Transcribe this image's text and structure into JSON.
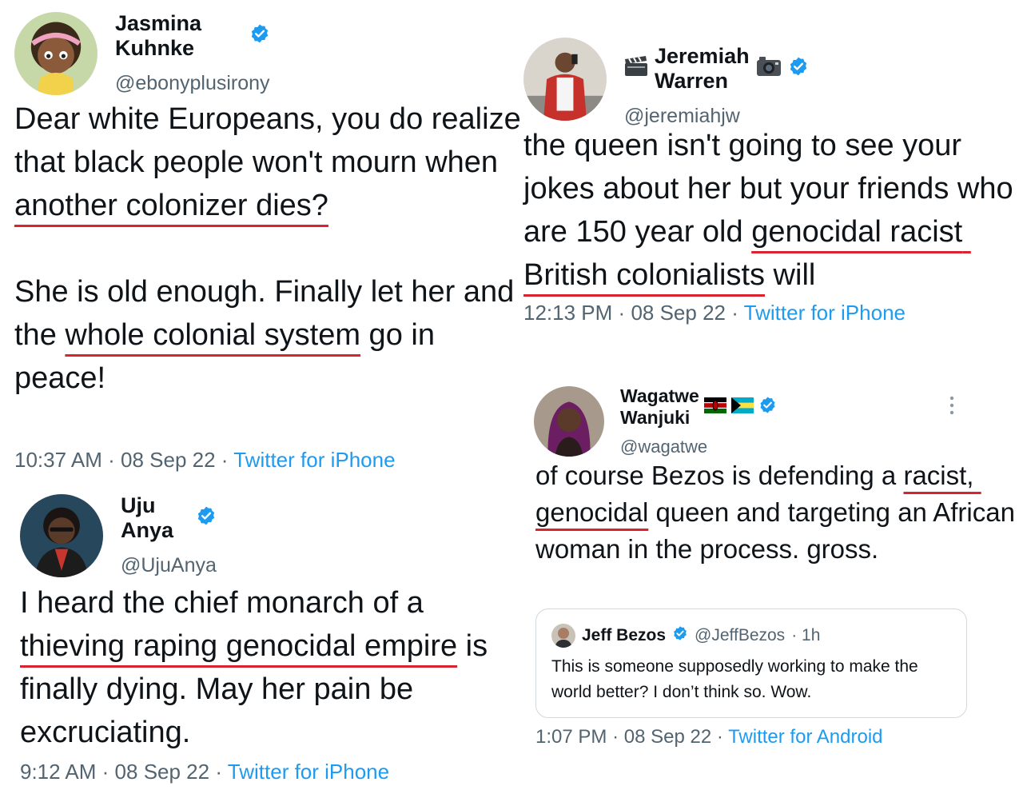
{
  "tweets": [
    {
      "name": "Jasmina Kuhnke",
      "handle": "@ebonyplusirony",
      "verified": true,
      "text_1": "Dear white Europeans, you do realize that black people won't mourn when ",
      "text_ul_1": "another colonizer dies?",
      "text_2": "\n\nShe is old enough. Finally let her and the ",
      "text_ul_2": "whole colonial system",
      "text_3": " go in peace!",
      "time": "10:37 AM",
      "date": "08 Sep 22",
      "source": "Twitter for iPhone",
      "separator": "·"
    },
    {
      "name": "Jeremiah Warren",
      "name_prefix_icon": "clapperboard-emoji-icon",
      "name_suffix_icon": "camera-emoji-icon",
      "handle": "@jeremiahjw",
      "verified": true,
      "text_1": "the queen isn't going to see your jokes about her but your friends who are 150 year old ",
      "text_ul_1": "genocidal racist British colonialists",
      "text_2": " will",
      "time": "12:13 PM",
      "date": "08 Sep 22",
      "source": "Twitter for iPhone",
      "separator": "·"
    },
    {
      "name": "Uju Anya",
      "handle": "@UjuAnya",
      "verified": true,
      "text_1": "I heard the chief monarch of a ",
      "text_ul_1": "thieving raping genocidal empire",
      "text_2": " is finally dying. May her pain be excruciating.",
      "time": "9:12 AM",
      "date": "08 Sep 22",
      "source": "Twitter for iPhone",
      "separator": "·"
    },
    {
      "name": "Wagatwe Wanjuki",
      "name_flags": [
        "kenya-flag-icon",
        "bahamas-flag-icon"
      ],
      "handle": "@wagatwe",
      "verified": true,
      "text_1": "of course Bezos is defending a ",
      "text_ul_1": "racist, genocidal",
      "text_2": " queen and targeting an African woman in the process. gross.",
      "time": "1:07 PM",
      "date": "08 Sep 22",
      "source": "Twitter for Android",
      "separator": "·",
      "more_icon": "vertical-ellipsis-icon",
      "quote": {
        "name": "Jeff Bezos",
        "handle": "@JeffBezos",
        "age": "· 1h",
        "text": "This is someone supposedly working to make the world better? I don’t think so. Wow."
      }
    }
  ],
  "colors": {
    "verified_blue": "#1d9bf0",
    "underline_red": "#d9232e",
    "muted_gray": "#536471",
    "text": "#0f1419"
  }
}
